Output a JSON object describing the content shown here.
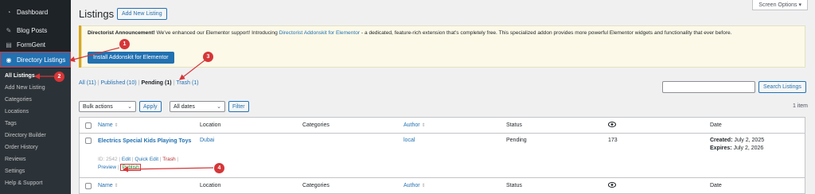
{
  "sidebar": {
    "items": [
      {
        "label": "Dashboard",
        "icon": "dashboard-icon",
        "glyph": "◔"
      },
      {
        "label": "Blog Posts",
        "icon": "pin-icon",
        "glyph": "✎"
      },
      {
        "label": "FormGent",
        "icon": "form-icon",
        "glyph": "▤"
      },
      {
        "label": "Directory Listings",
        "icon": "directory-icon",
        "glyph": "◉"
      }
    ],
    "submenu": [
      "All Listings",
      "Add New Listing",
      "Categories",
      "Locations",
      "Tags",
      "Directory Builder",
      "Order History",
      "Reviews",
      "Settings",
      "Help & Support"
    ]
  },
  "header": {
    "title": "Listings",
    "add_new_label": "Add New Listing",
    "screen_options_label": "Screen Options ▾"
  },
  "notice": {
    "strong": "Directorist Announcement!",
    "text1": " We've enhanced our Elementor support! Introducing ",
    "link": "Directorist Addonskit for Elementor",
    "text2": " - a dedicated, feature-rich extension that's completely free. This specialized addon provides more powerful Elementor widgets and functionality that ever before.",
    "button_label": "Install Addonskit for Elementor"
  },
  "views": {
    "all": "All (11)",
    "published": "Published (10)",
    "pending": "Pending (1)",
    "trash": "Trash (1)"
  },
  "search": {
    "button_label": "Search Listings",
    "placeholder": ""
  },
  "filters": {
    "bulk_actions": "Bulk actions",
    "apply": "Apply",
    "all_dates": "All dates",
    "filter": "Filter",
    "items_count": "1 item"
  },
  "table": {
    "columns": [
      "Name",
      "Location",
      "Categories",
      "Author",
      "Status",
      "Date"
    ],
    "rows": [
      {
        "title": "Electrics Special Kids Playing Toys",
        "location": "Dubai",
        "categories": "",
        "author": "local",
        "status": "Pending",
        "views": "173",
        "created_label": "Created:",
        "created": " July 2, 2025",
        "expires_label": "Expires:",
        "expires": " July 2, 2026",
        "id": "ID: 2542",
        "actions": {
          "edit": "Edit",
          "quick_edit": "Quick Edit",
          "trash": "Trash",
          "preview": "Preview",
          "publish": "Publish"
        }
      }
    ]
  },
  "annotations": [
    "1",
    "2",
    "3",
    "4"
  ],
  "colors": {
    "accent": "#2271b1",
    "annotation": "#d63638",
    "sidebar": "#1d2327"
  }
}
